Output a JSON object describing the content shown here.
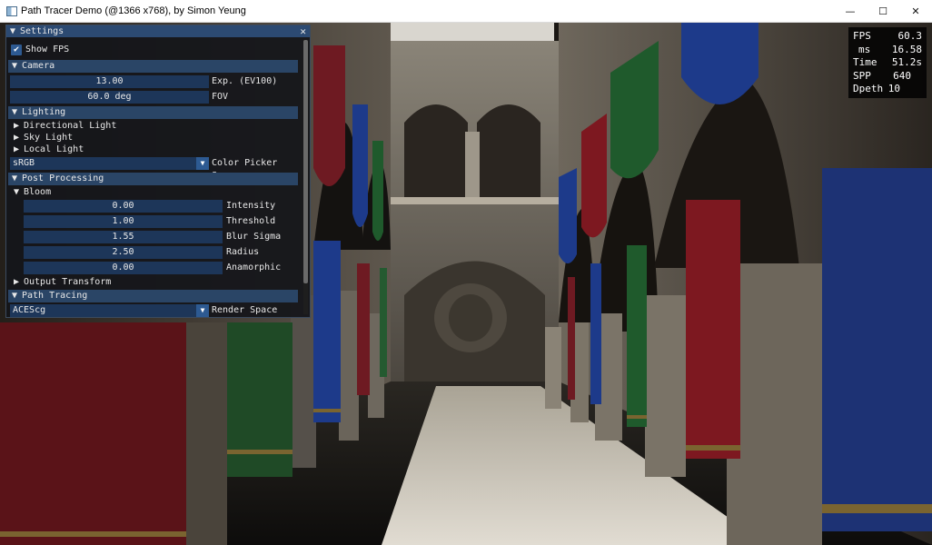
{
  "window": {
    "title": "Path Tracer Demo (@1366 x768), by Simon Yeung",
    "minimize_glyph": "—",
    "maximize_glyph": "☐",
    "close_glyph": "✕"
  },
  "stats": {
    "fps_label": "FPS",
    "fps_value": "60.3",
    "ms_label": "ms",
    "ms_value": "16.58",
    "time_label": "Time",
    "time_value": "51.2s",
    "spp_label": "SPP",
    "spp_value": "640",
    "depth_label": "Dpeth",
    "depth_value": "10"
  },
  "settings": {
    "title": "Settings",
    "close_glyph": "✕",
    "collapse_open": "▼",
    "tree_closed": "▶",
    "check_glyph": "✔",
    "show_fps": {
      "label": "Show FPS",
      "checked": true
    },
    "camera": {
      "header": "Camera",
      "exposure": {
        "value": "13.00",
        "label": "Exp. (EV100)"
      },
      "fov": {
        "value": "60.0 deg",
        "label": "FOV"
      }
    },
    "lighting": {
      "header": "Lighting",
      "directional": "Directional Light",
      "sky": "Sky Light",
      "local": "Local Light",
      "color_space": {
        "value": "sRGB",
        "label": "Color Picker Space"
      }
    },
    "post": {
      "header": "Post Processing",
      "bloom": "Bloom",
      "intensity": {
        "value": "0.00",
        "label": "Intensity"
      },
      "threshold": {
        "value": "1.00",
        "label": "Threshold"
      },
      "blur_sigma": {
        "value": "1.55",
        "label": "Blur Sigma"
      },
      "radius": {
        "value": "2.50",
        "label": "Radius"
      },
      "anamorphic": {
        "value": "0.00",
        "label": "Anamorphic"
      },
      "output_transform": "Output Transform"
    },
    "path_tracing": {
      "header": "Path Tracing",
      "render_space": {
        "value": "ACEScg",
        "label": "Render Space"
      }
    }
  },
  "colors": {
    "title_blue": "#2c4a72",
    "field_blue": "#1d3659",
    "check_blue": "#2d5a92",
    "curtain_red": "#7d1820",
    "curtain_green": "#1f5a2c",
    "curtain_blue": "#1d3a8a"
  }
}
